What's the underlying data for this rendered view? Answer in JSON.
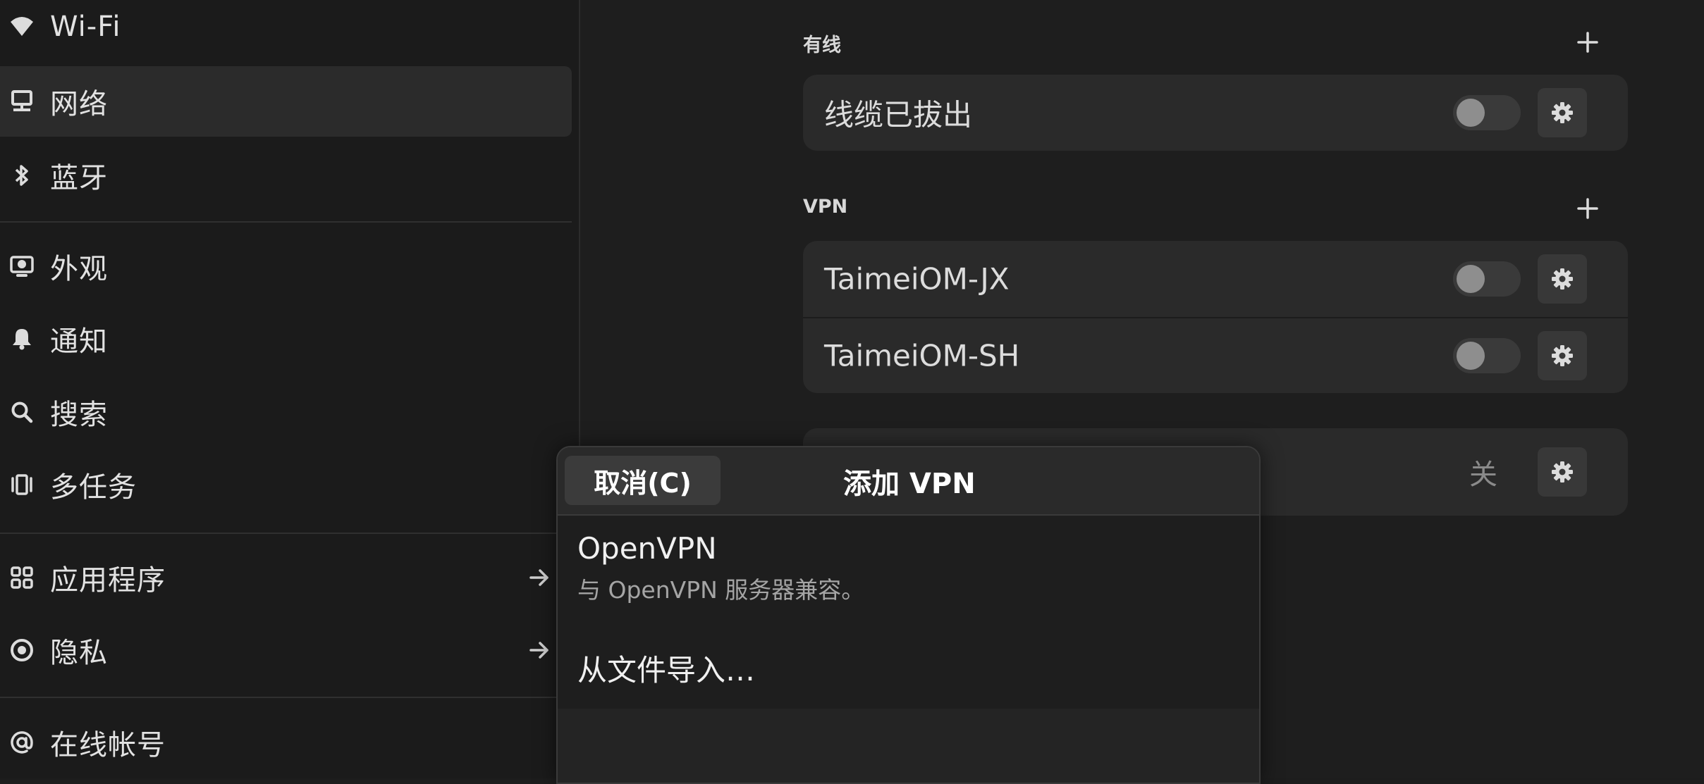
{
  "sidebar": {
    "items": [
      {
        "label": "Wi-Fi",
        "icon": "wifi-icon"
      },
      {
        "label": "网络",
        "icon": "network-icon"
      },
      {
        "label": "蓝牙",
        "icon": "bluetooth-icon"
      },
      {
        "label": "外观",
        "icon": "appearance-icon"
      },
      {
        "label": "通知",
        "icon": "bell-icon"
      },
      {
        "label": "搜索",
        "icon": "search-icon"
      },
      {
        "label": "多任务",
        "icon": "multitasking-icon"
      },
      {
        "label": "应用程序",
        "icon": "apps-grid-icon"
      },
      {
        "label": "隐私",
        "icon": "privacy-icon"
      },
      {
        "label": "在线帐号",
        "icon": "at-sign-icon"
      }
    ],
    "selected": "网络"
  },
  "main": {
    "wired": {
      "title": "有线",
      "rows": [
        {
          "label": "线缆已拔出",
          "toggle": "off"
        }
      ]
    },
    "vpn": {
      "title": "VPN",
      "rows": [
        {
          "label": "TaimeiOM-JX",
          "toggle": "off"
        },
        {
          "label": "TaimeiOM-SH",
          "toggle": "off"
        }
      ]
    },
    "proxy_row": {
      "status": "关"
    }
  },
  "dialog": {
    "cancel_label": "取消(C)",
    "title": "添加 VPN",
    "options": [
      {
        "title": "OpenVPN",
        "subtitle": "与 OpenVPN 服务器兼容。"
      },
      {
        "title": "从文件导入…"
      }
    ]
  },
  "colors": {
    "background": "#1e1e1e",
    "card": "#2a2a2a",
    "selected_item": "#2b2b2b"
  }
}
